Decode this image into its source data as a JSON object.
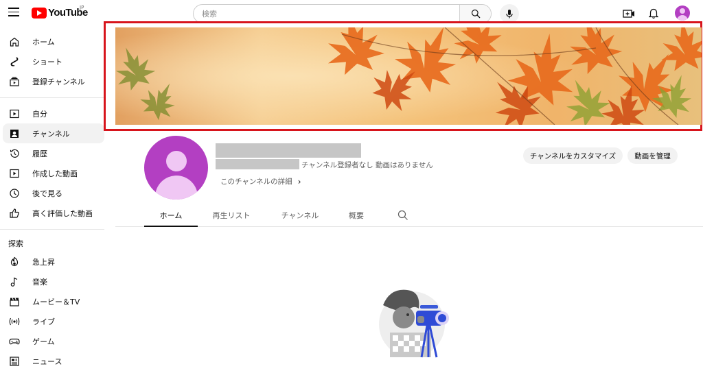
{
  "app": {
    "logo_text": "YouTube",
    "region": "JP"
  },
  "search": {
    "placeholder": "検索"
  },
  "sidebar": {
    "primary": [
      {
        "label": "ホーム",
        "icon": "home-icon"
      },
      {
        "label": "ショート",
        "icon": "shorts-icon"
      },
      {
        "label": "登録チャンネル",
        "icon": "subscriptions-icon"
      }
    ],
    "you": [
      {
        "label": "自分",
        "icon": "your-channel-icon"
      },
      {
        "label": "チャンネル",
        "icon": "channel-icon",
        "active": true
      },
      {
        "label": "履歴",
        "icon": "history-icon"
      },
      {
        "label": "作成した動画",
        "icon": "your-videos-icon"
      },
      {
        "label": "後で見る",
        "icon": "watch-later-icon"
      },
      {
        "label": "高く評価した動画",
        "icon": "liked-videos-icon"
      }
    ],
    "explore_title": "探索",
    "explore": [
      {
        "label": "急上昇",
        "icon": "trending-icon"
      },
      {
        "label": "音楽",
        "icon": "music-icon"
      },
      {
        "label": "ムービー＆TV",
        "icon": "movies-icon"
      },
      {
        "label": "ライブ",
        "icon": "live-icon"
      },
      {
        "label": "ゲーム",
        "icon": "gaming-icon"
      },
      {
        "label": "ニュース",
        "icon": "news-icon"
      }
    ]
  },
  "channel": {
    "meta": "チャンネル登録者なし  動画はありません",
    "details_link": "このチャンネルの詳細",
    "customize_button": "チャンネルをカスタマイズ",
    "manage_button": "動画を管理"
  },
  "tabs": [
    {
      "label": "ホーム",
      "active": true
    },
    {
      "label": "再生リスト"
    },
    {
      "label": "チャンネル"
    },
    {
      "label": "概要"
    }
  ],
  "colors": {
    "brand_red": "#ff0000",
    "avatar": "#b33fc2",
    "highlight_frame": "#d7141c"
  }
}
